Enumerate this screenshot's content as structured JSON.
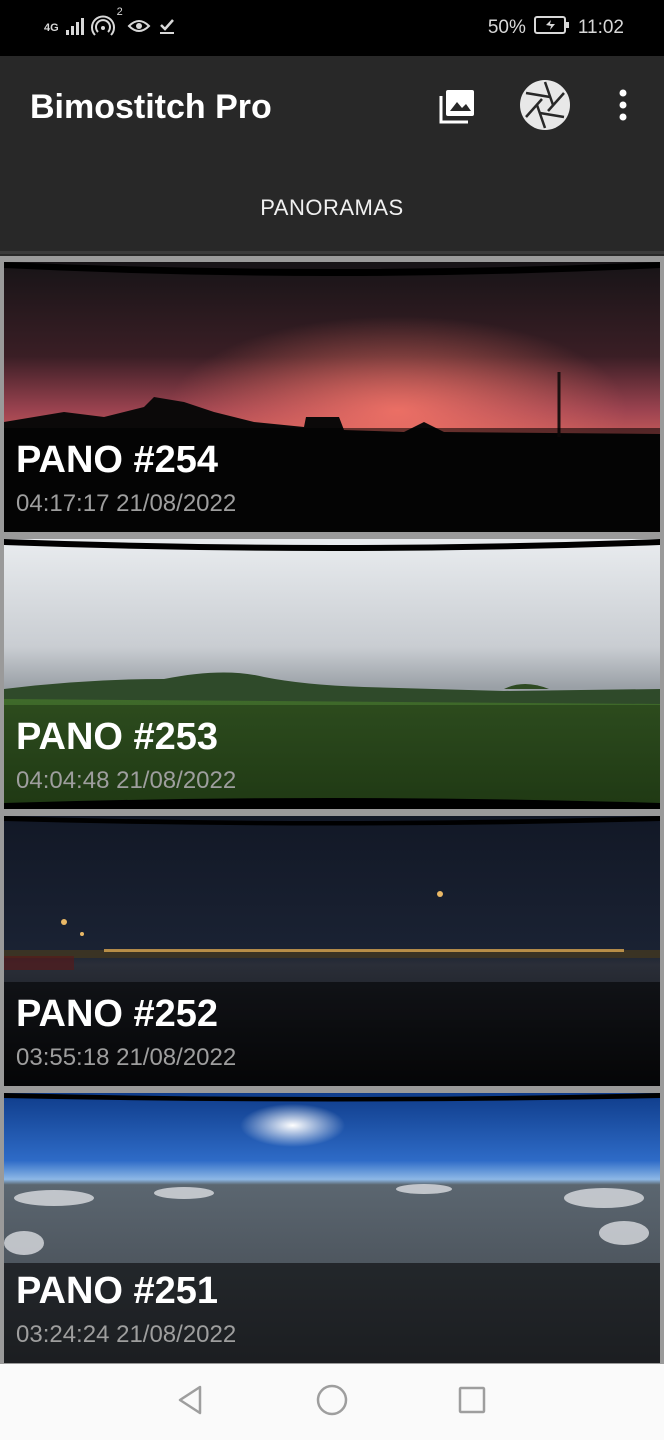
{
  "status_bar": {
    "network": "4G",
    "hotspot_count": "2",
    "battery": "50%",
    "time": "11:02"
  },
  "app_bar": {
    "title": "Bimostitch Pro",
    "icons": [
      "gallery-icon",
      "camera-shutter-icon",
      "more-vert-icon"
    ]
  },
  "tabs": [
    {
      "label": "PANORAMAS",
      "selected": true
    }
  ],
  "panoramas": [
    {
      "title": "PANO #254",
      "date": "04:17:17 21/08/2022",
      "scene": "sunset-silhouette"
    },
    {
      "title": "PANO #253",
      "date": "04:04:48 21/08/2022",
      "scene": "green-field-hills"
    },
    {
      "title": "PANO #252",
      "date": "03:55:18 21/08/2022",
      "scene": "night-waterfront"
    },
    {
      "title": "PANO #251",
      "date": "03:24:24 21/08/2022",
      "scene": "snowy-aerial-sun"
    }
  ],
  "nav_bar": {
    "icons": [
      "back-icon",
      "home-icon",
      "recents-icon"
    ]
  },
  "colors": {
    "status_bar": "#000000",
    "app_bar": "#282828",
    "list_background": "#9a9a9a",
    "date_text": "#9e9e9e",
    "nav_bar": "#fafafa"
  }
}
